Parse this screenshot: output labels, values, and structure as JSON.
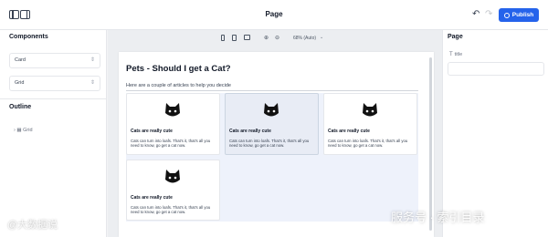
{
  "header": {
    "title": "Page",
    "publish_label": "Publish",
    "accent_color": "#2563eb"
  },
  "left_panel": {
    "components_title": "Components",
    "components": [
      {
        "label": "Card",
        "icon": "drag-handle-icon"
      },
      {
        "label": "Grid",
        "icon": "drag-handle-icon"
      }
    ],
    "outline_title": "Outline",
    "outline_items": [
      {
        "label": "Grid",
        "icon": "chevron-right-icon"
      }
    ]
  },
  "canvas": {
    "zoom_label": "68% (Auto)",
    "page": {
      "heading": "Pets - Should I get a Cat?",
      "subtitle": "Here are a couple of articles to help you decide",
      "cards": [
        {
          "title": "Cats are really cute",
          "description": "Cats can turn into loafs. That's it, that's all you need to know, go get a cat now.",
          "selected": false
        },
        {
          "title": "Cats are really cute",
          "description": "Cats can turn into loafs. That's it, that's all you need to know, go get a cat now.",
          "selected": true
        },
        {
          "title": "Cats are really cute",
          "description": "Cats can turn into loafs. That's it, that's all you need to know, go get a cat now.",
          "selected": false
        },
        {
          "title": "Cats are really cute",
          "description": "Cats can turn into loafs. That's it, that's all you need to know, go get a cat now.",
          "selected": false
        }
      ]
    }
  },
  "right_panel": {
    "title": "Page",
    "field_label": "title",
    "field_value": ""
  },
  "watermarks": {
    "left": "@大数据说",
    "right": "服务号 · 索引目录"
  }
}
